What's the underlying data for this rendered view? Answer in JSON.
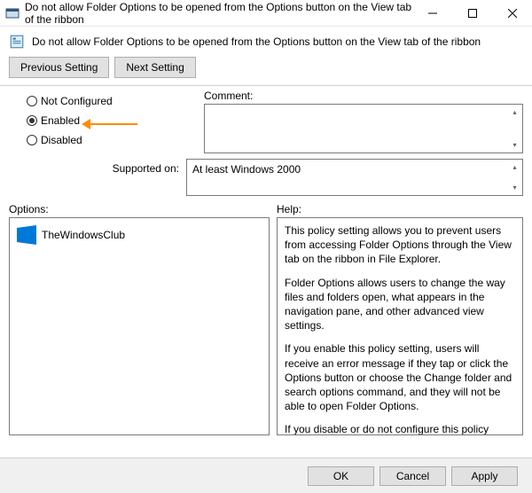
{
  "window": {
    "title": "Do not allow Folder Options to be opened from the Options button on the View tab of the ribbon"
  },
  "subheader": {
    "text": "Do not allow Folder Options to be opened from the Options button on the View tab of the ribbon"
  },
  "toolbar": {
    "previous_label": "Previous Setting",
    "next_label": "Next Setting"
  },
  "radios": {
    "not_configured": "Not Configured",
    "enabled": "Enabled",
    "disabled": "Disabled",
    "selected": "enabled"
  },
  "fields": {
    "comment_label": "Comment:",
    "comment_value": "",
    "supported_label": "Supported on:",
    "supported_value": "At least Windows 2000"
  },
  "panes": {
    "options_label": "Options:",
    "help_label": "Help:",
    "brand_text": "TheWindowsClub",
    "help_p1": "This policy setting allows you to prevent users from accessing Folder Options through the View tab on the ribbon in File Explorer.",
    "help_p2": "Folder Options allows users to change the way files and folders open, what appears in the navigation pane, and other advanced view settings.",
    "help_p3": "If you enable this policy setting, users will receive an error message if they tap or click the Options button or choose the Change folder and search options command, and they will not be able to open Folder Options.",
    "help_p4": "If you disable or do not configure this policy setting, users can open Folder Options from the View tab on the ribbon."
  },
  "footer": {
    "ok": "OK",
    "cancel": "Cancel",
    "apply": "Apply"
  }
}
